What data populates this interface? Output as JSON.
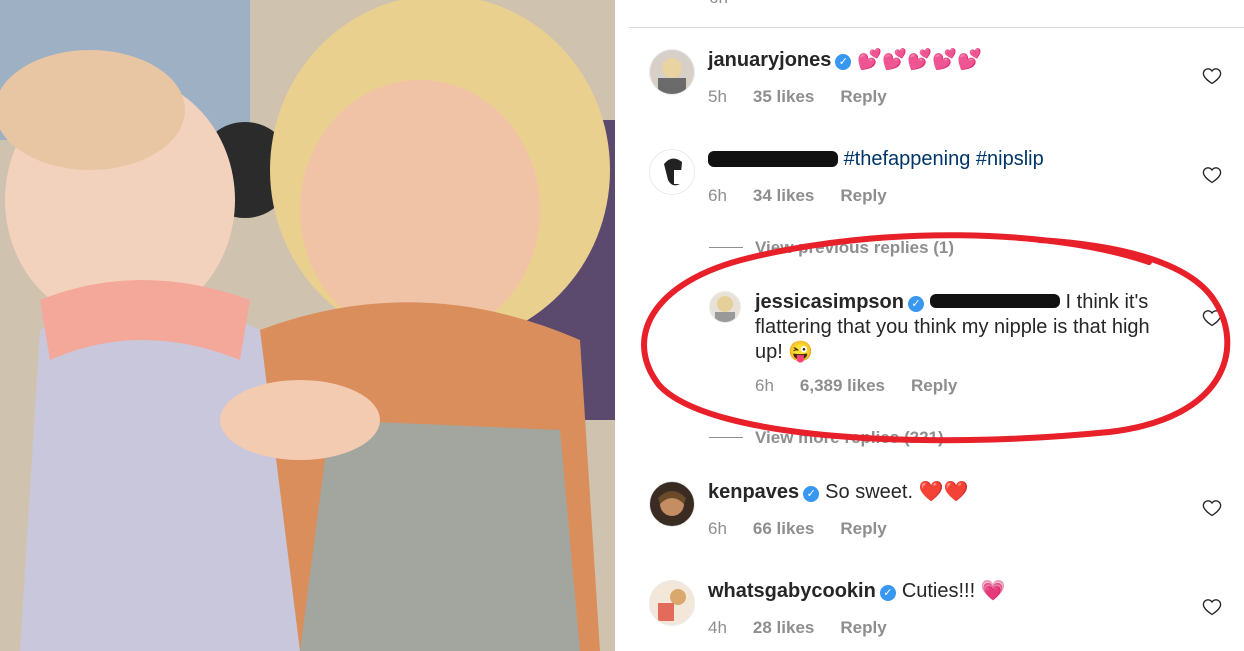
{
  "comments": [
    {
      "user": "januaryjones",
      "text": "💕💕💕💕💕",
      "time": "5h",
      "likes": "35 likes",
      "reply": "Reply"
    },
    {
      "user": "",
      "text": "#thefappening #nipslip",
      "time": "6h",
      "likes": "34 likes",
      "reply": "Reply"
    },
    {
      "user": "jessicasimpson",
      "text": "I think it's flattering that you think my nipple is that high up! 😜",
      "time": "6h",
      "likes": "6,389 likes",
      "reply": "Reply"
    },
    {
      "user": "kenpaves",
      "text": "So sweet. ❤️❤️",
      "time": "6h",
      "likes": "66 likes",
      "reply": "Reply"
    },
    {
      "user": "whatsgabycookin",
      "text": "Cuties!!! 💗",
      "time": "4h",
      "likes": "28 likes",
      "reply": "Reply"
    }
  ],
  "threads": {
    "previous": "View previous replies (1)",
    "more": "View more replies (221)"
  },
  "top_partial": "6h",
  "colors": {
    "circle": "#e8202a",
    "verified": "#3897f0",
    "hashtag": "#003569"
  }
}
